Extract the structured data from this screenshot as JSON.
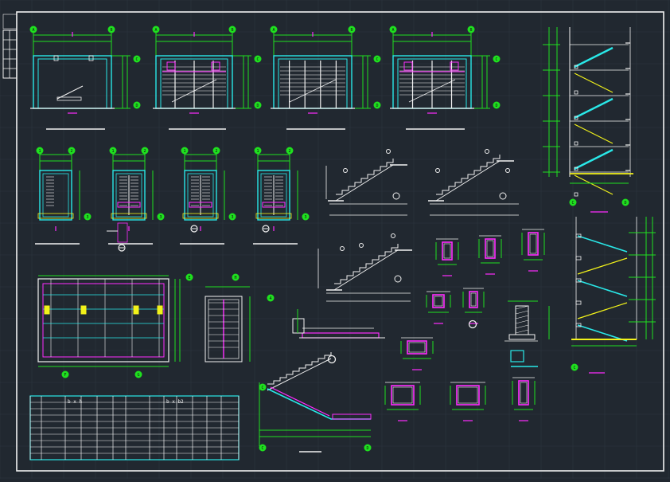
{
  "drawing": {
    "background": "#212830",
    "colors": {
      "green": "#1fe01f",
      "cyan": "#29e8e8",
      "magenta": "#ff2cff",
      "white": "#f2f2f2",
      "yellow": "#f2f21a",
      "grid": "#2c3540"
    },
    "axis_labels": [
      "A",
      "B",
      "C",
      "D",
      "E",
      "F",
      "G",
      "H",
      "1",
      "2",
      "3",
      "4"
    ],
    "title_block_cells": [
      "",
      "",
      "",
      "",
      ""
    ]
  },
  "schedule": {
    "headers": [
      "",
      "",
      "b x h",
      "",
      "",
      "",
      "",
      "",
      "b x b2",
      "",
      "",
      "",
      "",
      ""
    ],
    "rows": 9
  }
}
